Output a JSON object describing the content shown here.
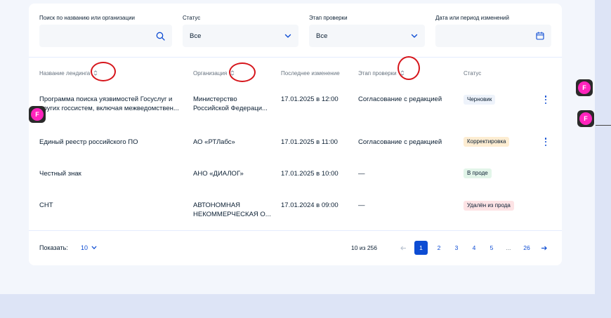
{
  "filters": {
    "search": {
      "label": "Поиск по названию или организации",
      "value": "",
      "icon": "search-icon"
    },
    "status": {
      "label": "Статус",
      "value": "Все",
      "icon": "chevron-down-icon"
    },
    "stage": {
      "label": "Этап проверки",
      "value": "Все",
      "icon": "chevron-down-icon"
    },
    "date": {
      "label": "Дата или период изменений",
      "value": "",
      "icon": "calendar-icon"
    }
  },
  "table": {
    "headers": {
      "name": "Название лендинга",
      "org": "Организация",
      "changed": "Последнее изменение",
      "stage": "Этап проверки",
      "status": "Статус"
    },
    "rows": [
      {
        "name1": "Программа поиска уязвимостей Госуслуг и",
        "name2": "других госсистем, включая межведомствен...",
        "org1": "Министерство",
        "org2": "Российской Федераци...",
        "changed": "17.01.2025 в 12:00",
        "stage": "Согласование с редакцией",
        "status": "Черновик"
      },
      {
        "name1": "Единый реестр российского ПО",
        "org1": "АО «РТЛабс»",
        "changed": "17.01.2025 в 11:00",
        "stage": "Согласование с редакцией",
        "status": "Корректировка"
      },
      {
        "name1": "Честный знак",
        "org1": "АНО «ДИАЛОГ»",
        "changed": "17.01.2025 в 10:00",
        "stage": "—",
        "status": "В проде"
      },
      {
        "name1": "СНТ",
        "org1": "АВТОНОМНАЯ",
        "org2": "НЕКОММЕРЧЕСКАЯ О...",
        "changed": "17.01.2024 в 09:00",
        "stage": "—",
        "status": "Удалён из прода"
      }
    ]
  },
  "footer": {
    "show_label": "Показать:",
    "page_size": "10",
    "range": "10 из 256",
    "pages": [
      "1",
      "2",
      "3",
      "4",
      "5",
      "...",
      "26"
    ],
    "prev_icon": "arrow-left-icon",
    "next_icon": "arrow-right-icon"
  },
  "figma_marker": "F",
  "colors": {
    "accent": "#0d4cd3",
    "annotation": "#d6151b",
    "figma_pink": "#ff24bd"
  }
}
